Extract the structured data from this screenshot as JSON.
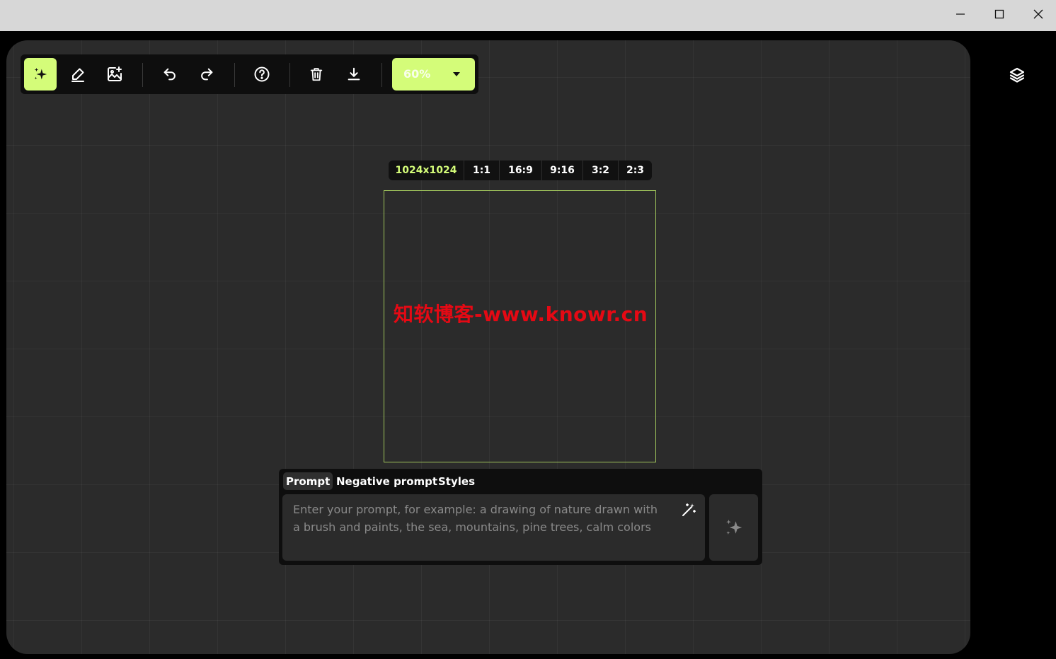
{
  "window": {
    "controls": [
      "minimize",
      "maximize",
      "close"
    ]
  },
  "toolbar": {
    "tools": [
      {
        "id": "generate",
        "icon": "sparkles-icon",
        "active": true
      },
      {
        "id": "eraser",
        "icon": "eraser-icon"
      },
      {
        "id": "add-image",
        "icon": "image-add-icon"
      },
      {
        "id": "undo",
        "icon": "undo-icon"
      },
      {
        "id": "redo",
        "icon": "redo-icon"
      },
      {
        "id": "help",
        "icon": "question-circle-icon"
      },
      {
        "id": "delete",
        "icon": "trash-icon"
      },
      {
        "id": "download",
        "icon": "download-icon"
      }
    ],
    "zoom": {
      "value": "60%",
      "icon": "caret-down-icon"
    }
  },
  "aspect_ratios": {
    "options": [
      "1024x1024",
      "1:1",
      "16:9",
      "9:16",
      "3:2",
      "2:3"
    ],
    "selected": "1024x1024"
  },
  "watermark": "知软博客-www.knowr.cn",
  "prompt_panel": {
    "tabs": [
      {
        "label": "Prompt",
        "active": true
      },
      {
        "label": "Negative prompt",
        "active": false
      },
      {
        "label": "Styles",
        "active": false
      }
    ],
    "input": {
      "value": "",
      "placeholder": "Enter your prompt, for example: a drawing of nature drawn with a brush and paints, the sea, mountains, pine trees, calm colors"
    },
    "magic_icon": "magic-wand-icon",
    "generate_icon": "sparkles-icon"
  },
  "sidebar": {
    "layers_icon": "layers-icon"
  },
  "colors": {
    "accent": "#d4fc79",
    "frame": "#9fc35b",
    "canvas": "#2b2b2b",
    "panel": "#0e0e0e",
    "watermark": "#e50914",
    "titlebar": "#d7d7d7"
  }
}
